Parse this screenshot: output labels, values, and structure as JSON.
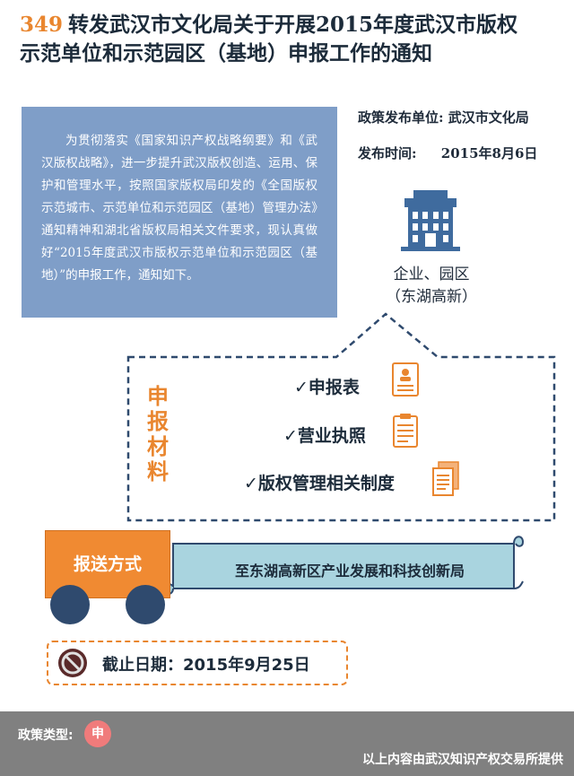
{
  "title": {
    "number": "349",
    "line1": "转发武汉市文化局关于开展2015年度武汉市版权",
    "line2": "示范单位和示范园区（基地）申报工作的通知"
  },
  "intro": "为贯彻落实《国家知识产权战略纲要》和《武汉版权战略》，进一步提升武汉版权创造、运用、保护和管理水平，按照国家版权局印发的《全国版权示范城市、示范单位和示范园区（基地）管理办法》通知精神和湖北省版权局相关文件要求，现认真做好“2015年度武汉市版权示范单位和示范园区（基地）”的申报工作，通知如下。",
  "meta": {
    "issuer_label": "政策发布单位:",
    "issuer": "武汉市文化局",
    "date_label": "发布时间:",
    "date": "2015年8月6日"
  },
  "entity": {
    "line1": "企业、园区",
    "line2": "（东湖高新）"
  },
  "materials": {
    "title_chars": [
      "申",
      "报",
      "材",
      "料"
    ],
    "check": "✓",
    "items": [
      "申报表",
      "营业执照",
      "版权管理相关制度"
    ]
  },
  "delivery": {
    "label": "报送方式",
    "destination": "至东湖高新区产业发展和科技创新局"
  },
  "deadline": {
    "label": "截止日期：",
    "date": "2015年9月25日"
  },
  "footer": {
    "type_label": "政策类型:",
    "type_badge": "申",
    "credit": "以上内容由武汉知识产权交易所提供"
  },
  "colors": {
    "accent_orange": "#e9862f",
    "intro_blue": "#7f9ec8",
    "dark_navy": "#2f4a6e",
    "banner_fill": "#a9d4df",
    "footer_gray": "#808080",
    "badge_pink": "#f07b7b"
  }
}
